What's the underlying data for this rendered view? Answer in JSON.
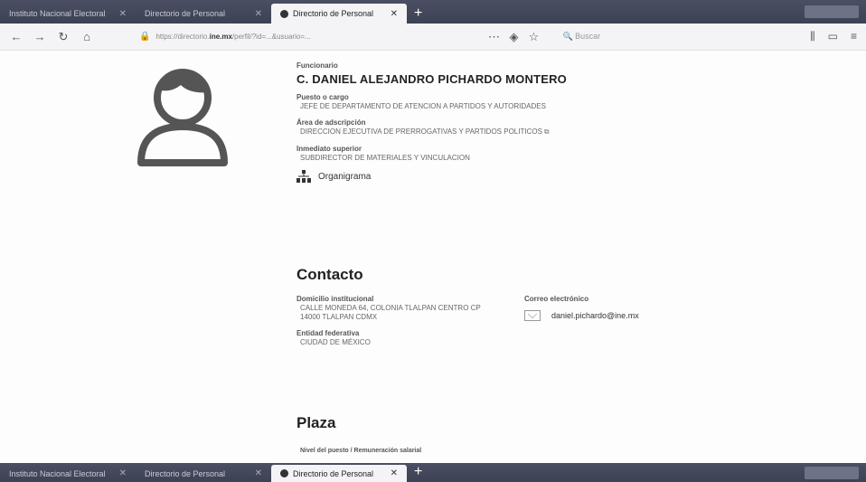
{
  "browser": {
    "tabs": [
      {
        "title": "Instituto Nacional Electoral",
        "active": false
      },
      {
        "title": "Directorio de Personal",
        "active": false
      },
      {
        "title": "Directorio de Personal",
        "active": true
      }
    ],
    "url_prefix": "https://directorio.",
    "url_domain": "ine.mx",
    "url_rest": "/perfil/?id=...&usuario=...",
    "search_placeholder": "Buscar"
  },
  "profile": {
    "role_label": "Funcionario",
    "name": "C. DANIEL ALEJANDRO PICHARDO MONTERO",
    "puesto_label": "Puesto o cargo",
    "puesto_value": "JEFE DE DEPARTAMENTO DE ATENCION A PARTIDOS Y AUTORIDADES",
    "area_label": "Área de adscripción",
    "area_value": "DIRECCION EJECUTIVA DE PRERROGATIVAS Y PARTIDOS POLITICOS",
    "superior_label": "Inmediato superior",
    "superior_value": "SUBDIRECTOR DE MATERIALES Y VINCULACION",
    "org_link": "Organigrama"
  },
  "contacto": {
    "title": "Contacto",
    "domicilio_label": "Domicilio institucional",
    "domicilio_line1": "CALLE MONEDA 64, COLONIA TLALPAN CENTRO CP",
    "domicilio_line2": "14000 TLALPAN CDMX",
    "entidad_label": "Entidad federativa",
    "entidad_value": "CIUDAD DE MÉXICO",
    "correo_label": "Correo electrónico",
    "email": "daniel.pichardo@ine.mx"
  },
  "plaza": {
    "title": "Plaza",
    "nivel_label": "Nivel del puesto / Remuneración salarial"
  }
}
